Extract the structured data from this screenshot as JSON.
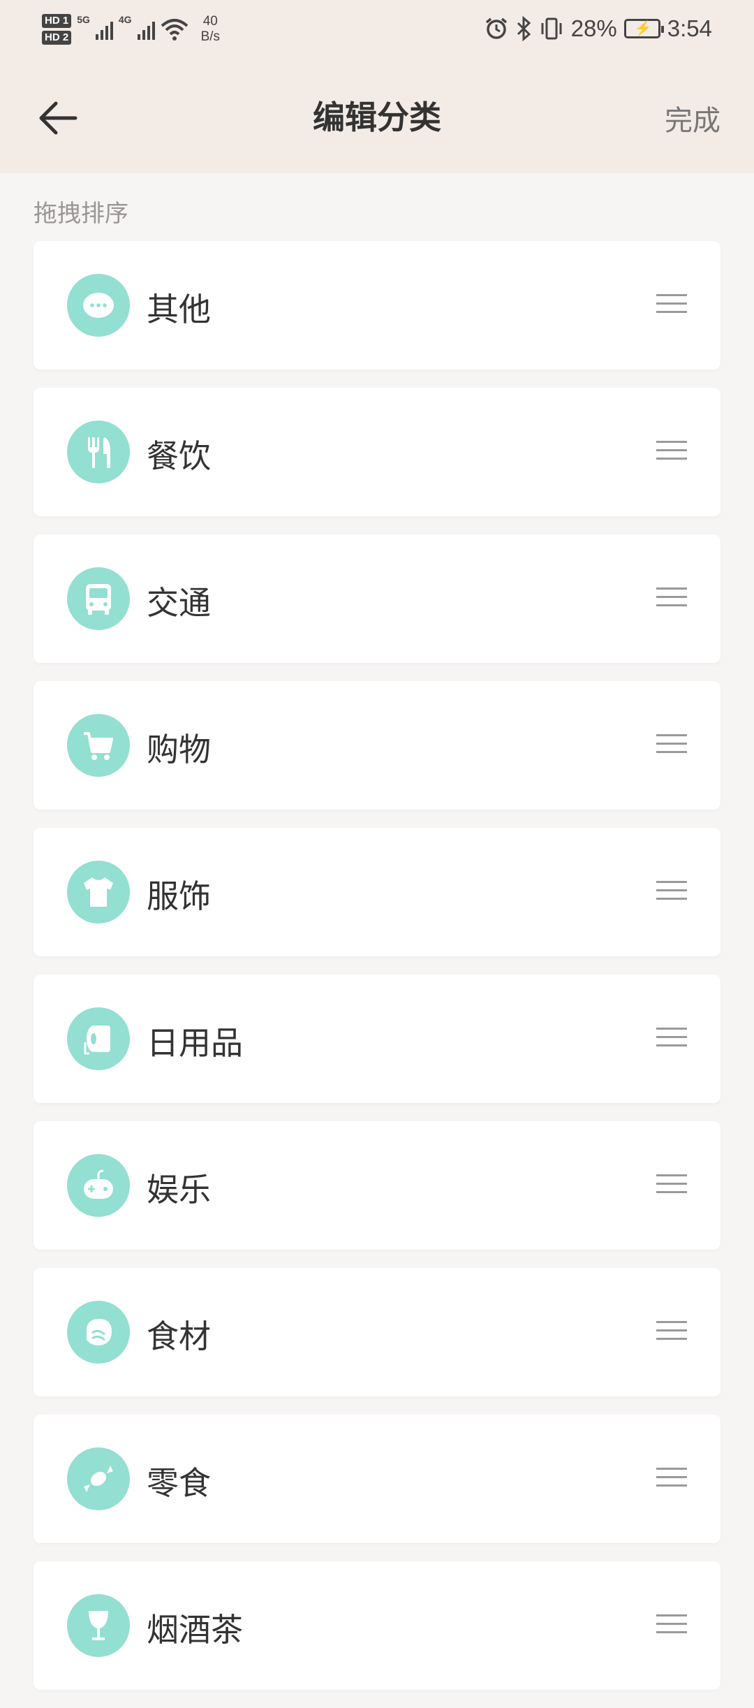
{
  "status_bar": {
    "sim1": "HD 1",
    "sim2": "HD 2",
    "net1": "5G",
    "net2": "4G",
    "speed_value": "40",
    "speed_unit": "B/s",
    "battery_percent": "28%",
    "time": "3:54"
  },
  "header": {
    "title": "编辑分类",
    "done_label": "完成"
  },
  "section_label": "拖拽排序",
  "accent_color": "#93dfd1",
  "categories": [
    {
      "label": "其他",
      "icon": "more-dots-icon"
    },
    {
      "label": "餐饮",
      "icon": "fork-knife-icon"
    },
    {
      "label": "交通",
      "icon": "bus-icon"
    },
    {
      "label": "购物",
      "icon": "shopping-cart-icon"
    },
    {
      "label": "服饰",
      "icon": "tshirt-icon"
    },
    {
      "label": "日用品",
      "icon": "toilet-paper-icon"
    },
    {
      "label": "娱乐",
      "icon": "gamepad-icon"
    },
    {
      "label": "食材",
      "icon": "meat-icon"
    },
    {
      "label": "零食",
      "icon": "candy-icon"
    },
    {
      "label": "烟酒茶",
      "icon": "wine-glass-icon"
    }
  ]
}
